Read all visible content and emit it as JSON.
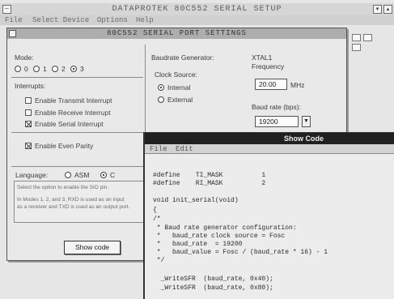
{
  "main_window": {
    "title": "DATAPROTEK 80C552 SERIAL SETUP",
    "menu": [
      "File",
      "Select Device",
      "Options",
      "Help"
    ]
  },
  "dialog": {
    "title": "80C552 SERIAL PORT SETTINGS",
    "mode": {
      "label": "Mode:",
      "options": [
        "0",
        "1",
        "2",
        "3"
      ],
      "selected": "3"
    },
    "interrupts": {
      "label": "Interrupts:",
      "items": [
        {
          "label": "Enable Transmit Interrupt",
          "checked": false
        },
        {
          "label": "Enable Receive Interrupt",
          "checked": false
        },
        {
          "label": "Enable Serial Interrupt",
          "checked": true
        }
      ]
    },
    "parity": {
      "label": "Enable Even Parity",
      "checked": true
    },
    "baud_generator": {
      "label": "Baudrate Generator:",
      "clock_source_label": "Clock Source:",
      "options": [
        "Internal",
        "External"
      ],
      "selected": "Internal",
      "xtal_label_1": "XTAL1",
      "xtal_label_2": "Frequency",
      "xtal_value": "20.00",
      "xtal_unit": "MHz",
      "baud_rate_label": "Baud rate (bps):",
      "baud_rate_value": "19200",
      "baud_rate_drop_icon": "chevron-down-icon"
    },
    "language": {
      "label": "Language:",
      "options": [
        "ASM",
        "C"
      ],
      "selected": "C"
    },
    "help_lines": [
      "Select the option to enable the SIO pin.",
      "In Modes 1, 2, and 3, RXD is used as an input",
      "as a receiver and TXD is used as an output port."
    ],
    "show_code_button": "Show code"
  },
  "code_window": {
    "title": "Show Code",
    "menu": [
      "File",
      "Edit"
    ],
    "lines": [
      "#define    TI_MASK          1",
      "#define    RI_MASK          2",
      "",
      "void init_serial(void)",
      "{",
      "/*",
      " * Baud rate generator configuration:",
      " *   baud_rate clock source = Fosc",
      " *   baud_rate  = 19200",
      " *   baud_value = Fosc / (baud_rate * 16) - 1",
      " */",
      "",
      "  _WriteSFR  (baud_rate, 0x40);",
      "  _WriteSFR  (baud_rate, 0x80);"
    ]
  }
}
